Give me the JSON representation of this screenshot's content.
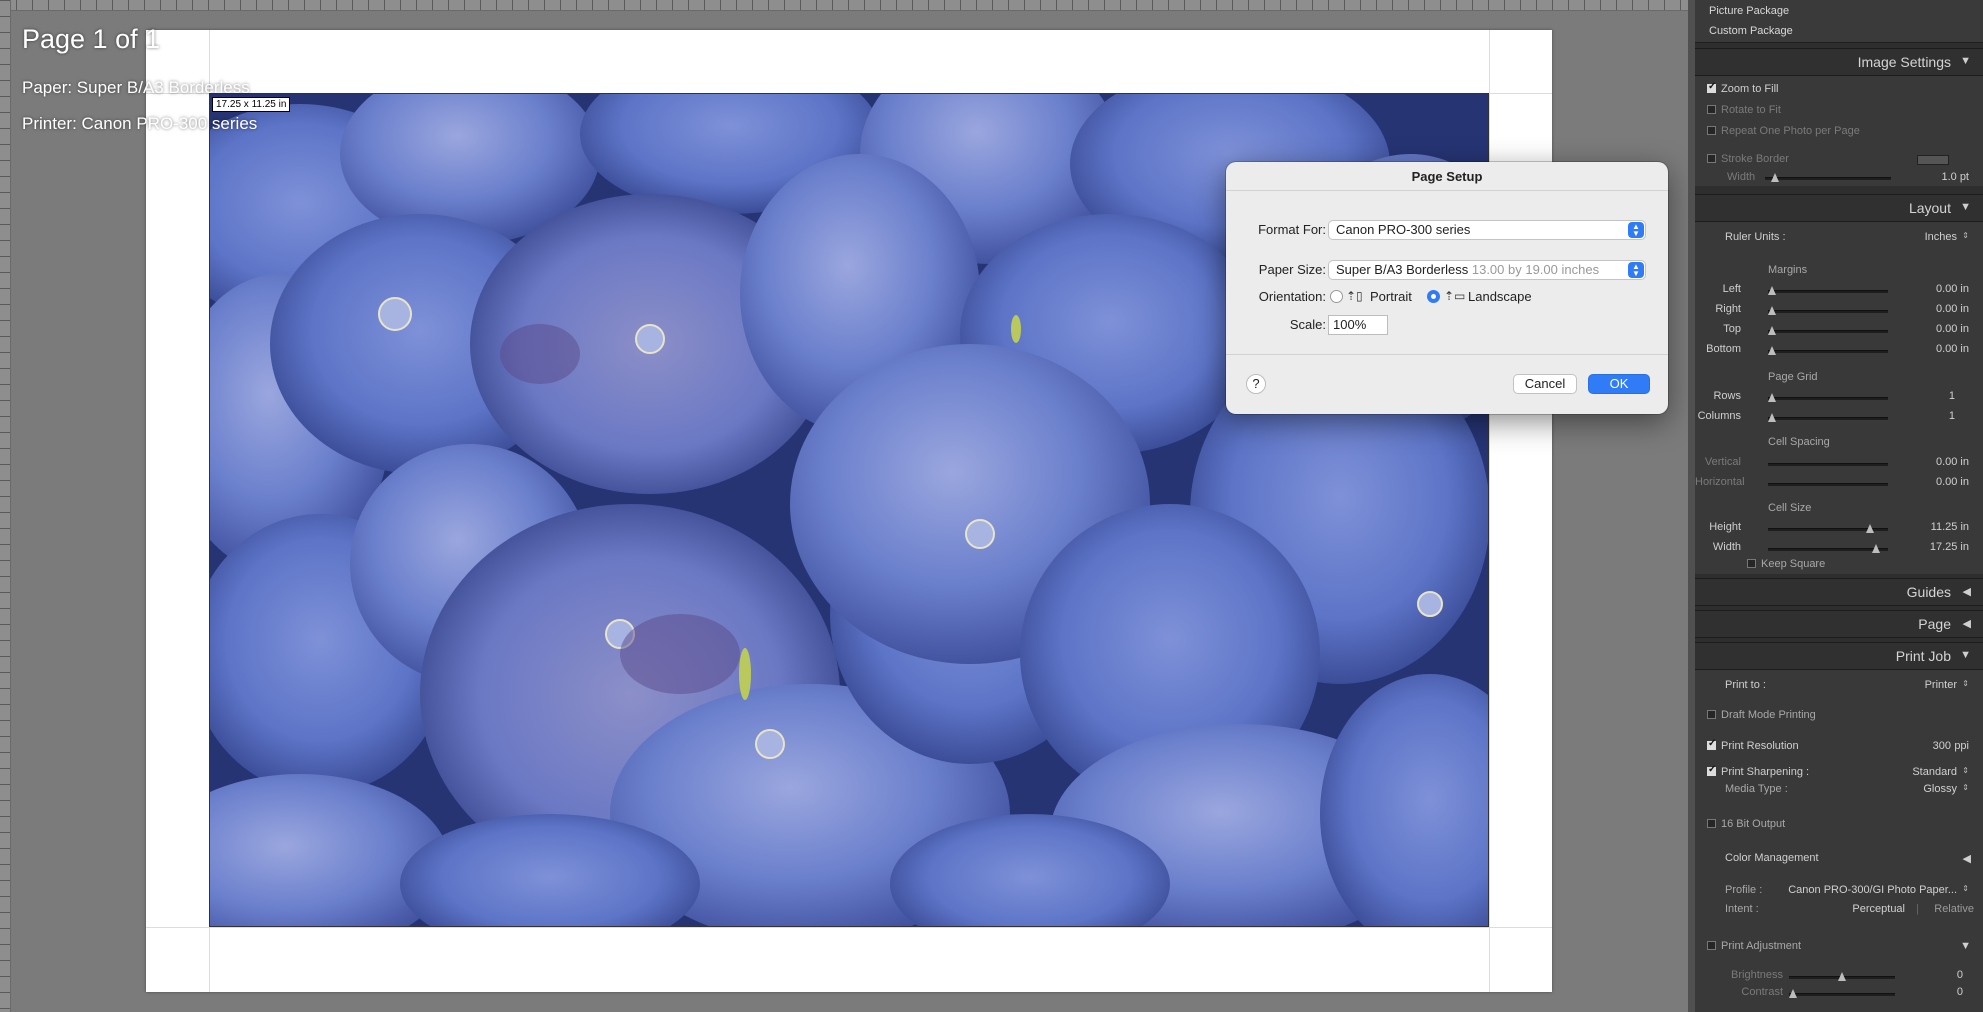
{
  "canvas": {
    "page_count": "Page 1 of 1",
    "paper_info": "Paper:  Super B/A3 Borderless",
    "printer_info": "Printer:  Canon PRO-300 series",
    "cell_size_tag": "17.25 x 11.25 in"
  },
  "dialog": {
    "title": "Page Setup",
    "format_for_label": "Format For:",
    "format_for_value": "Canon PRO-300 series",
    "paper_size_label": "Paper Size:",
    "paper_size_value": "Super B/A3 Borderless",
    "paper_size_dims": "13.00 by 19.00 inches",
    "orientation_label": "Orientation:",
    "portrait_label": "Portrait",
    "landscape_label": "Landscape",
    "orientation_selected": "Landscape",
    "scale_label": "Scale:",
    "scale_value": "100%",
    "help_label": "?",
    "cancel_label": "Cancel",
    "ok_label": "OK",
    "accent_color": "#2f7cf6"
  },
  "panel": {
    "templates": [
      "Picture Package",
      "Custom Package"
    ],
    "image_settings": {
      "title": "Image Settings",
      "zoom_to_fill": "Zoom to Fill",
      "zoom_to_fill_checked": true,
      "rotate_to_fit": "Rotate to Fit",
      "rotate_to_fit_checked": false,
      "repeat_one_photo": "Repeat One Photo per Page",
      "repeat_one_photo_checked": false,
      "stroke_border": "Stroke Border",
      "stroke_border_checked": false,
      "stroke_width_label": "Width",
      "stroke_width_value": "1.0 pt"
    },
    "layout": {
      "title": "Layout",
      "ruler_units_label": "Ruler Units :",
      "ruler_units_value": "Inches",
      "margins_heading": "Margins",
      "left_label": "Left",
      "left_value": "0.00 in",
      "right_label": "Right",
      "right_value": "0.00 in",
      "top_label": "Top",
      "top_value": "0.00 in",
      "bottom_label": "Bottom",
      "bottom_value": "0.00 in",
      "page_grid_heading": "Page Grid",
      "rows_label": "Rows",
      "rows_value": "1",
      "columns_label": "Columns",
      "columns_value": "1",
      "cell_spacing_heading": "Cell Spacing",
      "vertical_label": "Vertical",
      "vertical_value": "0.00 in",
      "horizontal_label": "Horizontal",
      "horizontal_value": "0.00 in",
      "cell_size_heading": "Cell Size",
      "height_label": "Height",
      "height_value": "11.25 in",
      "width_label": "Width",
      "width_value": "17.25 in",
      "keep_square": "Keep Square",
      "keep_square_checked": false
    },
    "guides_title": "Guides",
    "page_title": "Page",
    "print_job": {
      "title": "Print Job",
      "print_to_label": "Print to :",
      "print_to_value": "Printer",
      "draft_mode": "Draft Mode Printing",
      "draft_mode_checked": false,
      "print_resolution": "Print Resolution",
      "print_resolution_checked": true,
      "resolution_value": "300",
      "resolution_unit": "ppi",
      "print_sharpening": "Print Sharpening :",
      "print_sharpening_checked": true,
      "sharpening_value": "Standard",
      "media_type_label": "Media Type :",
      "media_type_value": "Glossy",
      "bit_output": "16 Bit Output",
      "bit_output_checked": false,
      "color_management": "Color Management",
      "profile_label": "Profile :",
      "profile_value": "Canon PRO-300/GI Photo Paper...",
      "intent_label": "Intent :",
      "intent_perceptual": "Perceptual",
      "intent_relative": "Relative",
      "print_adjustment": "Print Adjustment",
      "print_adjustment_checked": false,
      "brightness_label": "Brightness",
      "brightness_value": "0",
      "contrast_label": "Contrast",
      "contrast_value": "0"
    }
  }
}
